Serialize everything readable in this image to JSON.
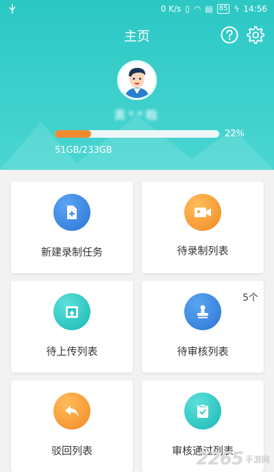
{
  "status_bar": {
    "network_speed": "0 K/s",
    "battery": "85",
    "time": "14:56"
  },
  "header": {
    "title": "主页"
  },
  "profile": {
    "username": "黄**翰"
  },
  "storage": {
    "used_fraction": 0.22,
    "percent_label": "22%",
    "usage_text": "51GB/233GB"
  },
  "colors": {
    "header_bg": "#2cc8c4",
    "progress": "#f08a30"
  },
  "tiles": [
    {
      "label": "新建录制任务",
      "icon": "new-file-icon",
      "color": "#3a8be6",
      "count": ""
    },
    {
      "label": "待录制列表",
      "icon": "video-camera-icon",
      "color": "#f5a03a",
      "count": ""
    },
    {
      "label": "待上传列表",
      "icon": "upload-icon",
      "color": "#26c9c4",
      "count": ""
    },
    {
      "label": "待审核列表",
      "icon": "stamp-icon",
      "color": "#3a8be6",
      "count": "5个"
    },
    {
      "label": "驳回列表",
      "icon": "reply-arrow-icon",
      "color": "#f5a03a",
      "count": ""
    },
    {
      "label": "审核通过列表",
      "icon": "clipboard-check-icon",
      "color": "#26c9c4",
      "count": ""
    }
  ],
  "watermark": {
    "brand": "2265",
    "suffix": "手游网"
  }
}
